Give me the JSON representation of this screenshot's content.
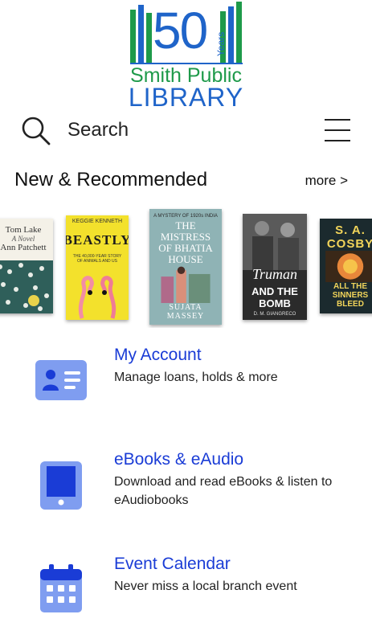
{
  "logo": {
    "number": "50",
    "years": "Years",
    "line1": "Smith Public",
    "line2": "LIBRARY"
  },
  "search": {
    "label": "Search"
  },
  "section": {
    "title": "New & Recommended",
    "more": "more >"
  },
  "books": [
    {
      "author": "Tom Lake",
      "sub": "A Novel",
      "title": "Ann Patchett"
    },
    {
      "author": "BEASTLY",
      "sub": "THE 40,000-YEAR STORY OF ANIMALS AND US",
      "title": "KEGGIE KENNETH"
    },
    {
      "author": "A MYSTERY OF 1920s INDIA",
      "sub": "THE MISTRESS OF BHATIA HOUSE",
      "title": "SUJATA MASSEY"
    },
    {
      "author": "Truman",
      "sub": "AND THE BOMB",
      "title": "D. M. GIANGRECO"
    },
    {
      "author": "S. A. COSBY",
      "sub": "ALL THE SINNERS BLEED",
      "title": ""
    }
  ],
  "items": [
    {
      "title": "My Account",
      "desc": "Manage loans, holds & more"
    },
    {
      "title": "eBooks & eAudio",
      "desc": "Download and read eBooks & listen to eAudiobooks"
    },
    {
      "title": "Event Calendar",
      "desc": "Never miss a local branch event"
    }
  ],
  "colors": {
    "logo_blue": "#1f64c9",
    "logo_green": "#1e9a4a",
    "link_blue": "#1a3cd6",
    "icon_light": "#7f9df0",
    "icon_dark": "#1a3cd6"
  },
  "icons": [
    "search-icon",
    "menu-icon",
    "account-card-icon",
    "tablet-icon",
    "calendar-icon"
  ]
}
